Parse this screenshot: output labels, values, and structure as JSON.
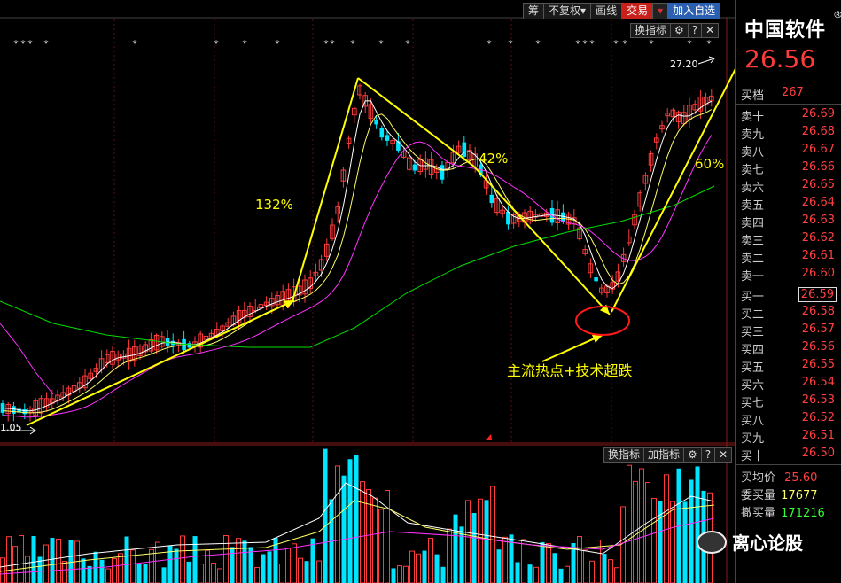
{
  "toolbar": {
    "chip": "筹",
    "restore": "不复权",
    "drawline": "画线",
    "trade": "交易",
    "add_watch": "加入自选"
  },
  "kline_toolbar": {
    "indicator": "换指标"
  },
  "volume_toolbar": {
    "indicator": "换指标",
    "add_indicator": "加指标"
  },
  "annotations": {
    "low_label": "1.05",
    "high_label": "27.20",
    "pct_132": "132%",
    "pct_42": "42%",
    "pct_60": "60%",
    "note": "主流热点+技术超跌"
  },
  "quote": {
    "name": "中国软件",
    "reg": "®",
    "last_price": "26.56",
    "diff_label": "买档",
    "diff_value": "267",
    "sells": [
      {
        "label": "卖十",
        "price": "26.69"
      },
      {
        "label": "卖九",
        "price": "26.68"
      },
      {
        "label": "卖八",
        "price": "26.67"
      },
      {
        "label": "卖七",
        "price": "26.66"
      },
      {
        "label": "卖六",
        "price": "26.65"
      },
      {
        "label": "卖五",
        "price": "26.64"
      },
      {
        "label": "卖四",
        "price": "26.63"
      },
      {
        "label": "卖三",
        "price": "26.62"
      },
      {
        "label": "卖二",
        "price": "26.61"
      },
      {
        "label": "卖一",
        "price": "26.60"
      }
    ],
    "buys": [
      {
        "label": "买一",
        "price": "26.59"
      },
      {
        "label": "买二",
        "price": "26.58"
      },
      {
        "label": "买三",
        "price": "26.57"
      },
      {
        "label": "买四",
        "price": "26.56"
      },
      {
        "label": "买五",
        "price": "26.55"
      },
      {
        "label": "买六",
        "price": "26.54"
      },
      {
        "label": "买七",
        "price": "26.53"
      },
      {
        "label": "买八",
        "price": "26.52"
      },
      {
        "label": "买九",
        "price": "26.51"
      },
      {
        "label": "买十",
        "price": "26.50"
      }
    ],
    "avg_buy_label": "买均价",
    "avg_buy": "25.60",
    "entrust_buy_label": "委买量",
    "entrust_buy": "17677",
    "cancel_buy_label": "撤买量",
    "cancel_buy": "171216"
  },
  "watermark": "离心论股",
  "colors": {
    "up": "#ff3b3b",
    "down": "#00e5ff",
    "ma5": "#ffffff",
    "ma10": "#ffff66",
    "ma20": "#ff33ff",
    "ma60": "#00dd00",
    "arrow": "#ffff00",
    "circle": "#ff1a1a"
  }
}
